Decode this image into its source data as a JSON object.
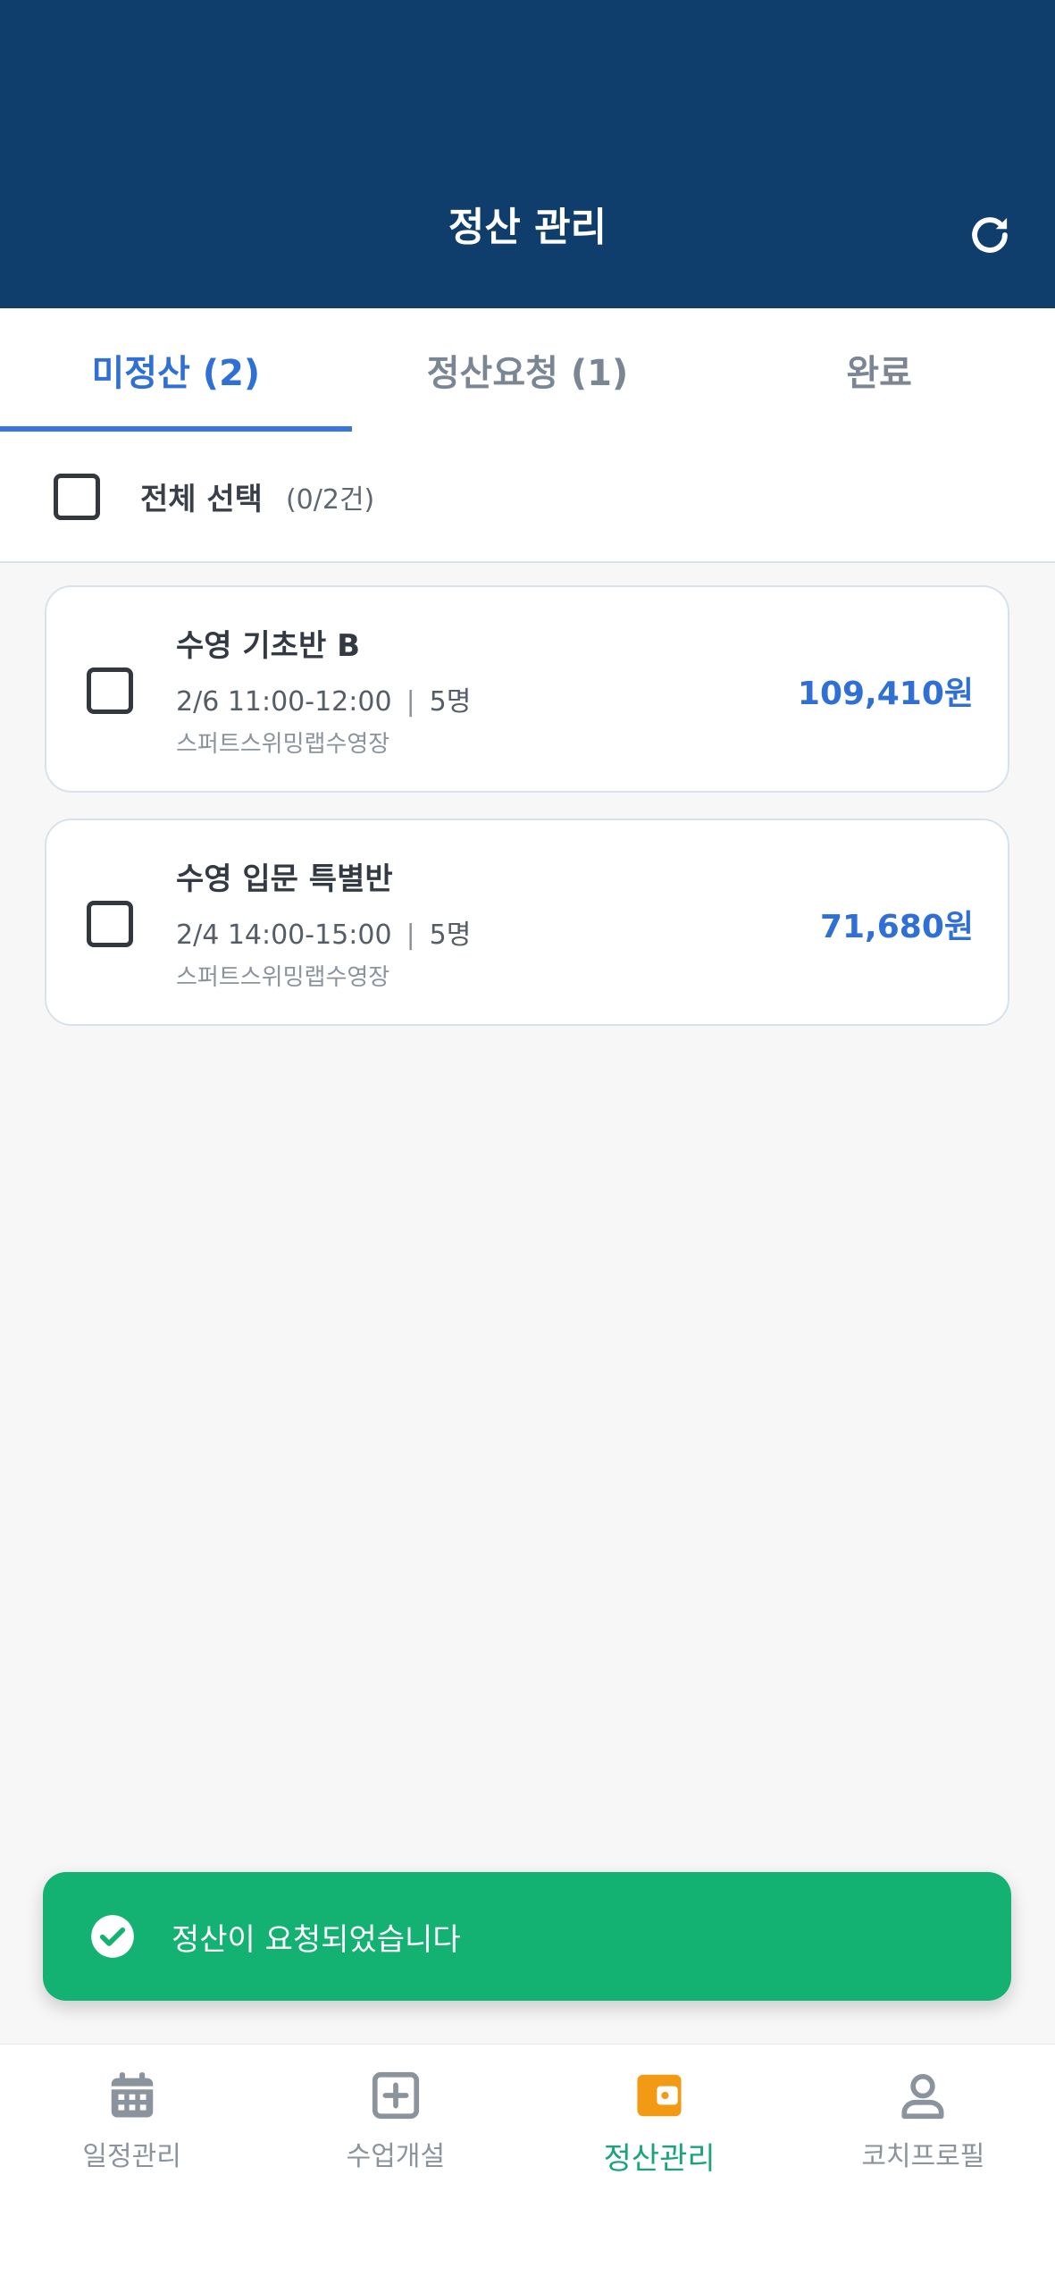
{
  "header": {
    "title": "정산 관리",
    "refresh_icon": "refresh-icon"
  },
  "tabs": [
    {
      "label": "미정산 (2)",
      "active": true
    },
    {
      "label": "정산요청 (1)",
      "active": false
    },
    {
      "label": "완료",
      "active": false
    }
  ],
  "select_all": {
    "label": "전체 선택",
    "count": "(0/2건)"
  },
  "items": [
    {
      "title": "수영 기초반 B",
      "datetime": "2/6 11:00-12:00",
      "sep": "|",
      "people": "5명",
      "place": "스퍼트스위밍랩수영장",
      "price": "109,410원"
    },
    {
      "title": "수영 입문 특별반",
      "datetime": "2/4 14:00-15:00",
      "sep": "|",
      "people": "5명",
      "place": "스퍼트스위밍랩수영장",
      "price": "71,680원"
    }
  ],
  "toast": {
    "message": "정산이 요청되었습니다",
    "icon": "check-circle-icon"
  },
  "bottom_nav": [
    {
      "label": "일정관리",
      "icon": "calendar-icon"
    },
    {
      "label": "수업개설",
      "icon": "plus-square-icon"
    },
    {
      "label": "정산관리",
      "icon": "wallet-icon",
      "active": true
    },
    {
      "label": "코치프로필",
      "icon": "user-icon"
    }
  ],
  "colors": {
    "header_bg": "#0f3e6c",
    "accent_blue": "#2f6fd6",
    "toast_green": "#13b273",
    "nav_active_text": "#19a57a",
    "nav_active_icon": "#f39a14"
  }
}
